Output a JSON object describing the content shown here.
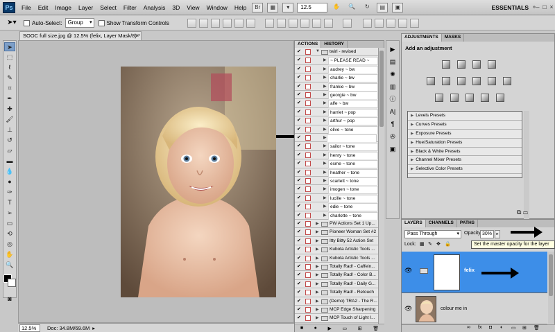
{
  "menubar": {
    "app_logo": "Ps",
    "items": [
      "File",
      "Edit",
      "Image",
      "Layer",
      "Select",
      "Filter",
      "Analysis",
      "3D",
      "View",
      "Window",
      "Help"
    ],
    "zoom": "12.5",
    "workspace": "ESSENTIALS"
  },
  "options": {
    "auto_select": "Auto-Select:",
    "auto_select_value": "Group",
    "show_transform": "Show Transform Controls"
  },
  "document": {
    "tab_title": "SOOC full size.jpg @ 12.5% (felix, Layer Mask/8) *",
    "close": "×"
  },
  "status": {
    "zoom": "12.5%",
    "doc": "Doc: 34.8M/69.6M"
  },
  "actions": {
    "tabs": [
      "ACTIONS",
      "HISTORY"
    ],
    "set_header": "twirl - revised",
    "items": [
      "~ PLEASE READ ~",
      "audrey ~ bw",
      "charlie ~ bw",
      "frankie ~ bw",
      "georgie ~ bw",
      "alfe ~ bw",
      "harriet ~ pop",
      "arthur ~ pop",
      "olive ~ tone",
      "felix ~ tone",
      "sailor ~ tone",
      "henry ~ tone",
      "esme ~ tone",
      "heather ~ tone",
      "scarlett ~ tone",
      "imogen ~ tone",
      "lucille ~ tone",
      "edie ~ tone",
      "charlotte ~ tone"
    ],
    "selected": "felix ~ tone",
    "sets": [
      "PW Actions Set 1 Up...",
      "Pioneer Woman Set #2",
      "Itty Bitty 52 Action Set",
      "Kubota Artistic Tools ...",
      "Kubota Artistic Tools ...",
      "Totally Rad! - Caffein...",
      "Totally Rad! - Color B...",
      "Totally Rad! - Daily G...",
      "Totally Rad! - Retouch",
      "(Demo) TRA2 - The R...",
      "MCP Edge Sharpening",
      "MCP Touch of Light I..."
    ]
  },
  "adjustments": {
    "tabs": [
      "ADJUSTMENTS",
      "MASKS"
    ],
    "title": "Add an adjustment",
    "presets": [
      "Levels Presets",
      "Curves Presets",
      "Exposure Presets",
      "Hue/Saturation Presets",
      "Black & White Presets",
      "Channel Mixer Presets",
      "Selective Color Presets"
    ]
  },
  "layers": {
    "tabs": [
      "LAYERS",
      "CHANNELS",
      "PATHS"
    ],
    "blend": "Pass Through",
    "opacity_label": "Opacity:",
    "opacity": "30%",
    "lock_label": "Lock:",
    "tooltip": "Set the master opacity for the layer",
    "layer1": "felix",
    "layer2": "colour me in"
  },
  "colors": {
    "selection": "#3d8ee8",
    "panel": "#d4d4d4"
  }
}
